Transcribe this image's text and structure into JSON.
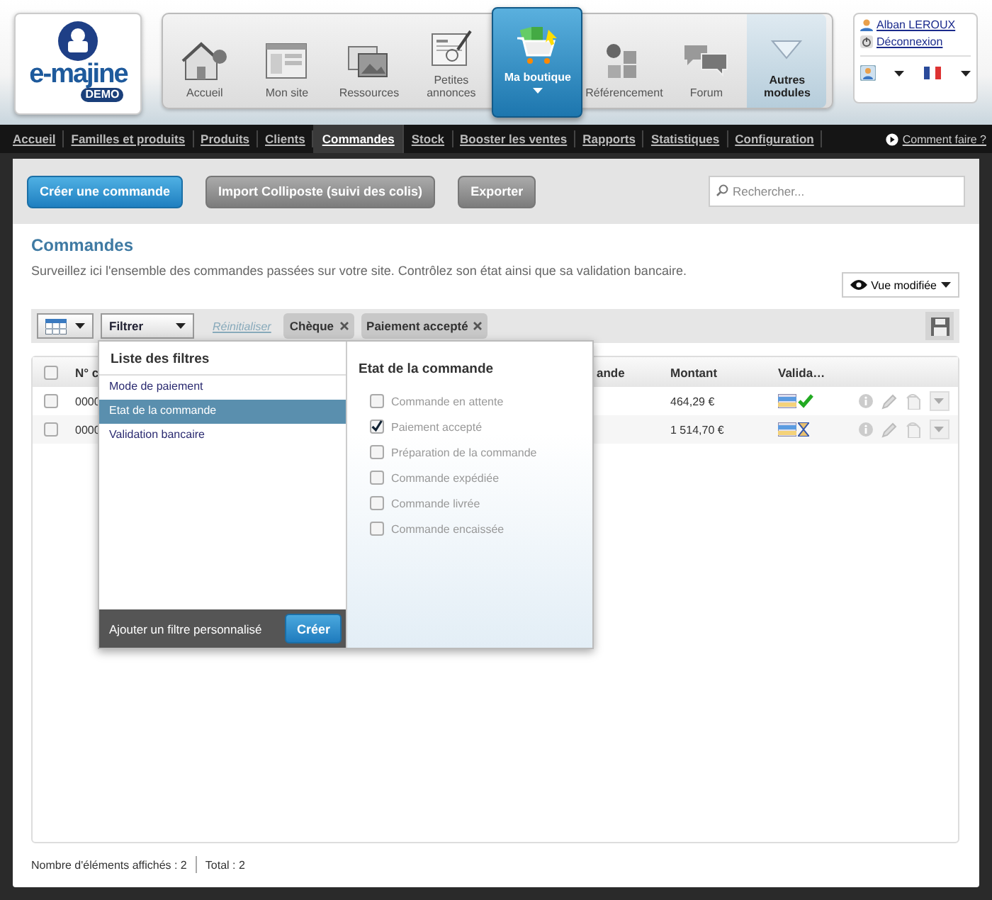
{
  "logo": {
    "name": "e-majine",
    "badge": "DEMO"
  },
  "modules": [
    {
      "label": "Accueil",
      "kind": "house",
      "selected": false
    },
    {
      "label": "Mon site",
      "kind": "browser",
      "selected": false
    },
    {
      "label": "Ressources",
      "kind": "photos",
      "selected": false
    },
    {
      "label": "Petites annonces",
      "kind": "newspaper",
      "selected": false
    },
    {
      "label": "Ma boutique",
      "kind": "cart",
      "selected": true
    },
    {
      "label": "Référencement",
      "kind": "blocks",
      "selected": false
    },
    {
      "label": "Forum",
      "kind": "bubbles",
      "selected": false
    },
    {
      "label": "Autres modules",
      "kind": "more",
      "selected": false
    }
  ],
  "user": {
    "name": "Alban LEROUX",
    "logout": "Déconnexion"
  },
  "nav": [
    {
      "label": "Accueil",
      "selected": false
    },
    {
      "label": "Familles et produits",
      "selected": false
    },
    {
      "label": "Produits",
      "selected": false
    },
    {
      "label": "Clients",
      "selected": false
    },
    {
      "label": "Commandes",
      "selected": true
    },
    {
      "label": "Stock",
      "selected": false
    },
    {
      "label": "Booster les ventes",
      "selected": false
    },
    {
      "label": "Rapports",
      "selected": false
    },
    {
      "label": "Statistiques",
      "selected": false
    },
    {
      "label": "Configuration",
      "selected": false
    }
  ],
  "help": "Comment faire ?",
  "actions": [
    {
      "label": "Créer une commande",
      "kind": "primary"
    },
    {
      "label": "Import Colliposte (suivi des colis)",
      "kind": "secondary"
    },
    {
      "label": "Exporter",
      "kind": "secondary"
    }
  ],
  "search": {
    "placeholder": "Rechercher..."
  },
  "page": {
    "title": "Commandes",
    "description": "Surveillez ici l'ensemble des commandes passées sur votre site. Contrôlez son état ainsi que sa validation bancaire.",
    "view": "Vue modifiée"
  },
  "filters": {
    "button": "Filtrer",
    "reset": "Réinitialiser",
    "chips": [
      "Chèque",
      "Paiement accepté"
    ]
  },
  "filter_menu": {
    "title": "Liste des filtres",
    "items": [
      {
        "label": "Mode de paiement",
        "selected": false
      },
      {
        "label": "Etat de la commande",
        "selected": true
      },
      {
        "label": "Validation bancaire",
        "selected": false
      }
    ],
    "add_label": "Ajouter un filtre personnalisé",
    "create": "Créer",
    "detail_title": "Etat de la commande",
    "options": [
      {
        "label": "Commande en attente",
        "checked": false
      },
      {
        "label": "Paiement accepté",
        "checked": true
      },
      {
        "label": "Préparation de la commande",
        "checked": false
      },
      {
        "label": "Commande expédiée",
        "checked": false
      },
      {
        "label": "Commande livrée",
        "checked": false
      },
      {
        "label": "Commande encaissée",
        "checked": false
      }
    ]
  },
  "table": {
    "select_all": false,
    "columns": [
      "N° c",
      "ande",
      "Montant",
      "Valida…"
    ],
    "rows": [
      {
        "checked": false,
        "number": "0000",
        "amount": "464,29 €",
        "validated": true
      },
      {
        "checked": false,
        "number": "0000",
        "amount": "1 514,70 €",
        "validated": false
      }
    ]
  },
  "footer": {
    "count": "Nombre d'éléments affichés : 2",
    "total": "Total : 2"
  }
}
